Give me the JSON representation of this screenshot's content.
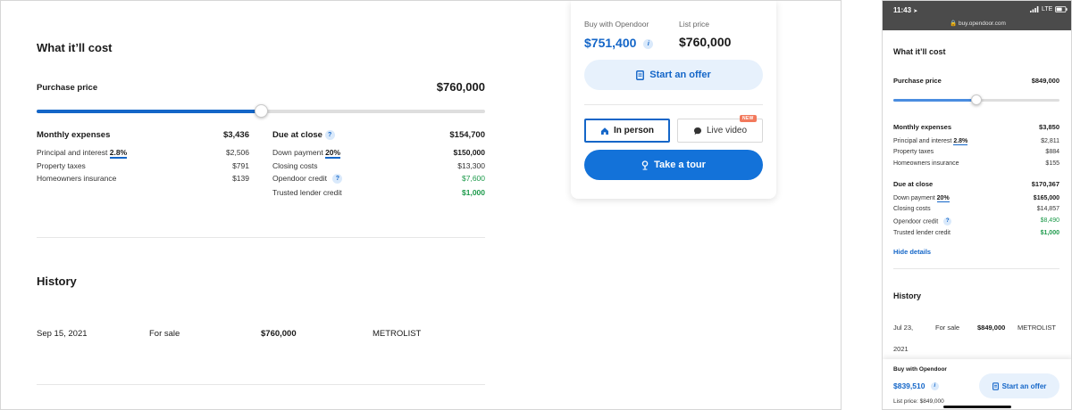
{
  "desktop": {
    "cost_title": "What it’ll cost",
    "purchase_price_label": "Purchase price",
    "purchase_price_value": "$760,000",
    "purchase_slider_fraction": 0.5,
    "monthly": {
      "label": "Monthly expenses",
      "total": "$3,436",
      "rows": [
        {
          "label": "Principal and interest",
          "pct": "2.8%",
          "value": "$2,506"
        },
        {
          "label": "Property taxes",
          "value": "$791"
        },
        {
          "label": "Homeowners insurance",
          "value": "$139"
        }
      ]
    },
    "due": {
      "label": "Due at close",
      "total": "$154,700",
      "rows": [
        {
          "label": "Down payment",
          "pct": "20%",
          "value": "$150,000"
        },
        {
          "label": "Closing costs",
          "value": "$13,300"
        },
        {
          "label": "Opendoor credit",
          "value": "$7,600"
        },
        {
          "label": "Trusted lender credit",
          "value": "$1,000"
        }
      ]
    },
    "history_title": "History",
    "history_rows": [
      {
        "date": "Sep 15, 2021",
        "event": "For sale",
        "price": "$760,000",
        "source": "METROLIST"
      }
    ],
    "offer_card": {
      "buy_label": "Buy with Opendoor",
      "buy_price": "$751,400",
      "list_label": "List price",
      "list_price": "$760,000",
      "start_offer": "Start an offer",
      "in_person": "In person",
      "live_video": "Live video",
      "new_badge": "NEW",
      "take_tour": "Take a tour"
    }
  },
  "phone": {
    "time": "11:43",
    "signal": "LTE",
    "url": "buy.opendoor.com",
    "cost_title": "What it’ll cost",
    "purchase_price_label": "Purchase price",
    "purchase_price_value": "$849,000",
    "purchase_slider_fraction": 0.5,
    "monthly": {
      "label": "Monthly expenses",
      "total": "$3,850",
      "rows": [
        {
          "label": "Principal and interest",
          "pct": "2.8%",
          "value": "$2,811"
        },
        {
          "label": "Property taxes",
          "value": "$884"
        },
        {
          "label": "Homeowners insurance",
          "value": "$155"
        }
      ]
    },
    "due": {
      "label": "Due at close",
      "total": "$170,367",
      "rows": [
        {
          "label": "Down payment",
          "pct": "20%",
          "value": "$165,000"
        },
        {
          "label": "Closing costs",
          "value": "$14,857"
        },
        {
          "label": "Opendoor credit",
          "value": "$8,490"
        },
        {
          "label": "Trusted lender credit",
          "value": "$1,000"
        }
      ]
    },
    "hide_details": "Hide details",
    "history_title": "History",
    "history_row": {
      "date_line1": "Jul 23,",
      "date_line2": "2021",
      "event": "For sale",
      "price": "$849,000",
      "source": "METROLIST"
    },
    "footer": {
      "buy_label": "Buy with Opendoor",
      "buy_price": "$839,510",
      "list_price": "List price: $849,000",
      "start_offer": "Start an offer"
    }
  }
}
